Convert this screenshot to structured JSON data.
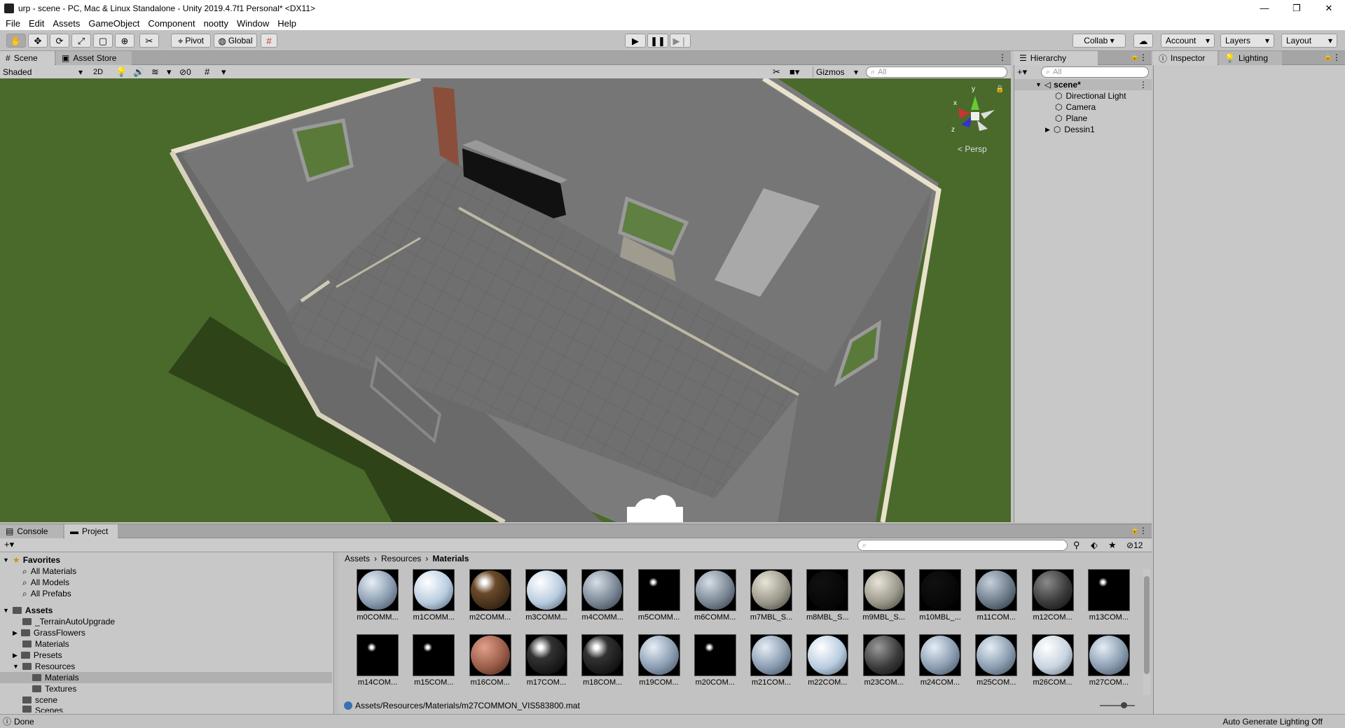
{
  "window": {
    "title": "urp - scene - PC, Mac & Linux Standalone - Unity 2019.4.7f1 Personal* <DX11>",
    "minimize": "—",
    "restore": "❐",
    "close": "✕"
  },
  "menu": [
    "File",
    "Edit",
    "Assets",
    "GameObject",
    "Component",
    "nootty",
    "Window",
    "Help"
  ],
  "toolbar": {
    "pivot": "Pivot",
    "global": "Global",
    "collab": "Collab ▾",
    "account": "Account",
    "layers": "Layers",
    "layout": "Layout"
  },
  "scene_panel": {
    "tab_scene": "Scene",
    "tab_asset_store": "Asset Store",
    "shading_mode": "Shaded",
    "toggle_2d": "2D",
    "hidden_count": "0",
    "gizmos": "Gizmos",
    "search_placeholder": "All",
    "persp_label": "< Persp",
    "axis_y": "y",
    "axis_x": "x",
    "axis_z": "z"
  },
  "hierarchy": {
    "tab": "Hierarchy",
    "search_placeholder": "All",
    "scene_name": "scene*",
    "items": [
      "Directional Light",
      "Camera",
      "Plane",
      "Dessin1"
    ]
  },
  "inspector": {
    "tab_inspector": "Inspector",
    "tab_lighting": "Lighting"
  },
  "bottom": {
    "tab_console": "Console",
    "tab_project": "Project",
    "hidden_count": "12",
    "favorites": {
      "label": "Favorites",
      "items": [
        "All Materials",
        "All Models",
        "All Prefabs"
      ]
    },
    "assets": {
      "label": "Assets",
      "items": [
        "_TerrainAutoUpgrade",
        "GrassFlowers",
        "Materials",
        "Presets",
        "Resources",
        "Materials",
        "Textures",
        "scene",
        "Scenes"
      ]
    },
    "breadcrumb": [
      "Assets",
      "Resources",
      "Materials"
    ],
    "materials": [
      "m0COMM...",
      "m1COMM...",
      "m2COMM...",
      "m3COMM...",
      "m4COMM...",
      "m5COMM...",
      "m6COMM...",
      "m7MBL_S...",
      "m8MBL_S...",
      "m9MBL_S...",
      "m10MBL_...",
      "m11COM...",
      "m12COM...",
      "m13COM...",
      "m14COM...",
      "m15COM...",
      "m16COM...",
      "m17COM...",
      "m18COM...",
      "m19COM...",
      "m20COM...",
      "m21COM...",
      "m22COM...",
      "m23COM...",
      "m24COM...",
      "m25COM...",
      "m26COM...",
      "m27COM..."
    ],
    "selected_path": "Assets/Resources/Materials/m27COMMON_VIS583800.mat"
  },
  "status": {
    "left": "Done",
    "right": "Auto Generate Lighting Off"
  },
  "colors": {
    "accent": "#3a72b0",
    "panel": "#c8c8c8",
    "grass": "#4b6b2c"
  }
}
